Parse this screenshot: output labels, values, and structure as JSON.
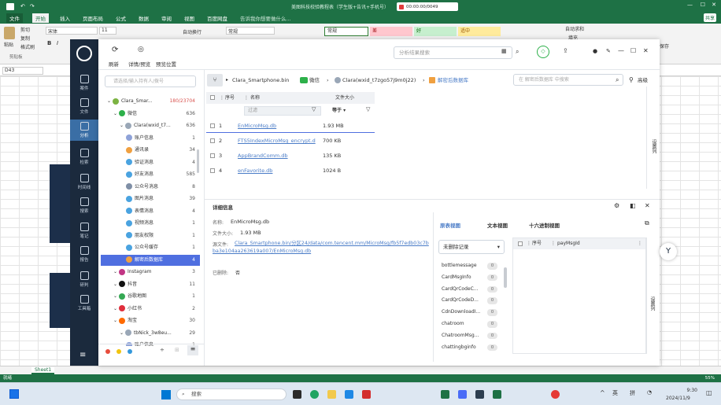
{
  "excel": {
    "title": "美图科技校验教程表（学生版+告讯+手机号）",
    "recorder_time": "00:00:00/0049",
    "tabs": [
      "文件",
      "开始",
      "插入",
      "页面布局",
      "公式",
      "数据",
      "审阅",
      "视图",
      "百度网盘"
    ],
    "active_tab": "开始",
    "tell_me": "告诉我你想要做什么...",
    "share": "共享",
    "clipboard": [
      "剪切",
      "复制",
      "格式刷"
    ],
    "paste": "粘贴",
    "clipboard_group": "剪贴板",
    "font_name": "宋体",
    "font_size": "11",
    "wrap": "自动换行",
    "number_format": "常规",
    "styles": [
      "常规",
      "差",
      "好",
      "适中"
    ],
    "autosum": "自动求和",
    "fill": "填充",
    "save": "保存",
    "name_box": "D43",
    "sheet_tab": "Sheet1",
    "status_left": "就绪",
    "zoom": "55%",
    "colors": {
      "brand": "#1e7145",
      "style_normal": "#ffffff",
      "style_bad": "#ffc7ce",
      "style_good": "#c6efce",
      "style_neutral": "#ffeb9c"
    }
  },
  "taskbar": {
    "search": "搜索",
    "ime": [
      "英",
      "拼"
    ],
    "time": "9:30",
    "date": "2024/11/9"
  },
  "app": {
    "nav": [
      {
        "label": "案件",
        "icon": "case-icon"
      },
      {
        "label": "文件",
        "icon": "file-icon"
      },
      {
        "label": "分析",
        "icon": "analysis-icon"
      },
      {
        "label": "检索",
        "icon": "search-map-icon"
      },
      {
        "label": "时间线",
        "icon": "timeline-icon"
      },
      {
        "label": "搜索",
        "icon": "search-icon"
      },
      {
        "label": "笔记",
        "icon": "notes-icon"
      },
      {
        "label": "报告",
        "icon": "report-icon"
      },
      {
        "label": "研判",
        "icon": "judge-icon"
      },
      {
        "label": "工具箱",
        "icon": "toolbox-icon"
      }
    ],
    "toolbar": {
      "refresh": "刷新",
      "detail": "详情/预览",
      "preview_pos": "预览位置",
      "search_placeholder": "分析结果搜索",
      "sort": "高级"
    },
    "tree_search_placeholder": "请选择/输入持有人/拨号",
    "tree": [
      {
        "label": "Clara_Smar...",
        "count": "180/23704",
        "level": 0,
        "icon": "android-icon",
        "color": "#7cb342"
      },
      {
        "label": "微信",
        "count": "636",
        "level": 1,
        "icon": "wechat-icon",
        "color": "#2db04a"
      },
      {
        "label": "Clara(wxid_t7...",
        "count": "636",
        "level": 2,
        "icon": "user-icon",
        "color": "#9aa7b7"
      },
      {
        "label": "账户信息",
        "count": "1",
        "level": 3,
        "icon": "account-icon",
        "color": "#8ea2d8"
      },
      {
        "label": "通讯录",
        "count": "34",
        "level": 3,
        "icon": "contacts-icon",
        "color": "#f0a040"
      },
      {
        "label": "验证消息",
        "count": "4",
        "level": 3,
        "icon": "verify-icon",
        "color": "#4aa3e0"
      },
      {
        "label": "好友消息",
        "count": "585",
        "level": 3,
        "icon": "friend-msg-icon",
        "color": "#4aa3e0"
      },
      {
        "label": "公众号消息",
        "count": "8",
        "level": 3,
        "icon": "official-icon",
        "color": "#7f8fa6"
      },
      {
        "label": "图片消息",
        "count": "39",
        "level": 3,
        "icon": "image-msg-icon",
        "color": "#4aa3e0"
      },
      {
        "label": "表情消息",
        "count": "4",
        "level": 3,
        "icon": "emoji-msg-icon",
        "color": "#4aa3e0"
      },
      {
        "label": "视频消息",
        "count": "1",
        "level": 3,
        "icon": "video-msg-icon",
        "color": "#4aa3e0"
      },
      {
        "label": "朋友权限",
        "count": "1",
        "level": 3,
        "icon": "privacy-icon",
        "color": "#4aa3e0"
      },
      {
        "label": "公众号缓存",
        "count": "1",
        "level": 3,
        "icon": "cache-icon",
        "color": "#4aa3e0"
      },
      {
        "label": "解密后数据库",
        "count": "4",
        "level": 3,
        "icon": "database-icon",
        "color": "#f0a040",
        "selected": true
      },
      {
        "label": "Instagram",
        "count": "3",
        "level": 1,
        "icon": "instagram-icon",
        "color": "#c13584"
      },
      {
        "label": "抖音",
        "count": "11",
        "level": 1,
        "icon": "douyin-icon",
        "color": "#111"
      },
      {
        "label": "谷歌地图",
        "count": "1",
        "level": 1,
        "icon": "gmaps-icon",
        "color": "#34a853"
      },
      {
        "label": "小红书",
        "count": "2",
        "level": 1,
        "icon": "xhs-icon",
        "color": "#e02e3c"
      },
      {
        "label": "淘宝",
        "count": "30",
        "level": 1,
        "icon": "taobao-icon",
        "color": "#ff6a00"
      },
      {
        "label": "tbNick_3w8eu...",
        "count": "29",
        "level": 2,
        "icon": "user-icon",
        "color": "#9aa7b7"
      },
      {
        "label": "账户信息",
        "count": "1",
        "level": 3,
        "icon": "account-icon",
        "color": "#8ea2d8"
      }
    ],
    "breadcrumb": [
      "Clara_Smartphone.bin",
      "微信",
      "Clara(wxid_t7zgo57j9m0j22)",
      "解密后数据库"
    ],
    "list_search_placeholder": "在 解密后数据库 中搜索",
    "columns": {
      "index": "序号",
      "name": "名称",
      "size": "文件大小",
      "filter_placeholder": "过滤",
      "size_op": "等于",
      "right_panel": "设置列"
    },
    "files": [
      {
        "index": "1",
        "name": "EnMicroMsg.db",
        "size": "1.93 MB"
      },
      {
        "index": "2",
        "name": "FTS5IndexMicroMsg_encrypt.d",
        "size": "700 KB"
      },
      {
        "index": "3",
        "name": "AppBrandComm.db",
        "size": "135 KB"
      },
      {
        "index": "4",
        "name": "enFavorite.db",
        "size": "1024 B"
      }
    ],
    "detail": {
      "title": "详细信息",
      "name_label": "名称:",
      "name": "EnMicroMsg.db",
      "size_label": "文件大小:",
      "size": "1.93 MB",
      "path_label": "源文件:",
      "path": "Clara_Smartphone.bin/分区24/data/com.tencent.mm/MicroMsg/fb5f7edb03c7bba3e104aa263619a007/EnMicroMsg.db",
      "deleted_label": "已删除:",
      "deleted": "否"
    },
    "views": [
      "原表视图",
      "文本视图",
      "十六进制视图"
    ],
    "record_filter": "未删除记录",
    "table_names": [
      "bottlemessage",
      "CardMsgInfo",
      "CardQrCodeC...",
      "CardQrCodeD...",
      "CdnDownloadI...",
      "chatroom",
      "ChatroomMsg...",
      "chattingbginfo"
    ],
    "table_counts": [
      "0",
      "0",
      "0",
      "0",
      "0",
      "0",
      "0",
      "0"
    ],
    "sub_columns": {
      "index": "序号",
      "col": "payMsgId",
      "right": "设置列"
    }
  }
}
